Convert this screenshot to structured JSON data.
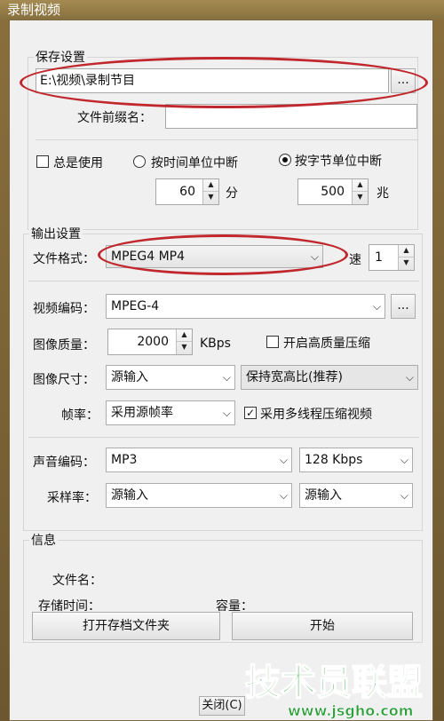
{
  "window": {
    "title": "录制视频"
  },
  "save_settings": {
    "group_title": "保存设置",
    "path_value": "E:\\视频\\录制节目",
    "browse_label": "...",
    "prefix_label": "文件前缀名：",
    "prefix_value": "",
    "always_use_label": "总是使用",
    "split_time_label": "按时间单位中断",
    "split_size_label": "按字节单位中断",
    "time_value": "60",
    "time_unit": "分",
    "size_value": "500",
    "size_unit": "兆"
  },
  "output_settings": {
    "group_title": "输出设置",
    "format_label": "文件格式：",
    "format_value": "MPEG4 MP4",
    "speed_label": "速",
    "speed_value": "1",
    "video_codec_label": "视频编码：",
    "video_codec_value": "MPEG-4",
    "codec_options_label": "...",
    "quality_label": "图像质量：",
    "quality_value": "2000",
    "quality_unit": "KBps",
    "hq_label": "开启高质量压缩",
    "size_label": "图像尺寸：",
    "size_value": "源输入",
    "aspect_value": "保持宽高比(推荐)",
    "fps_label": "帧率：",
    "fps_value": "采用源帧率",
    "multithread_label": "采用多线程压缩视频",
    "audio_codec_label": "声音编码：",
    "audio_codec_value": "MP3",
    "audio_bitrate_value": "128 Kbps",
    "samplerate_label": "采样率：",
    "samplerate_value": "源输入",
    "channel_value": "源输入"
  },
  "info": {
    "group_title": "信息",
    "filename_label": "文件名：",
    "duration_label": "存储时间：",
    "capacity_label": "容量："
  },
  "buttons": {
    "open_folder": "打开存档文件夹",
    "start": "开始",
    "close": "关闭(C)"
  },
  "watermark": {
    "brand": "技术员联盟",
    "url": "www.jsgho.com"
  },
  "colors": {
    "highlight_ellipse": "#c0282e",
    "watermark_green": "#2e9e3a"
  }
}
